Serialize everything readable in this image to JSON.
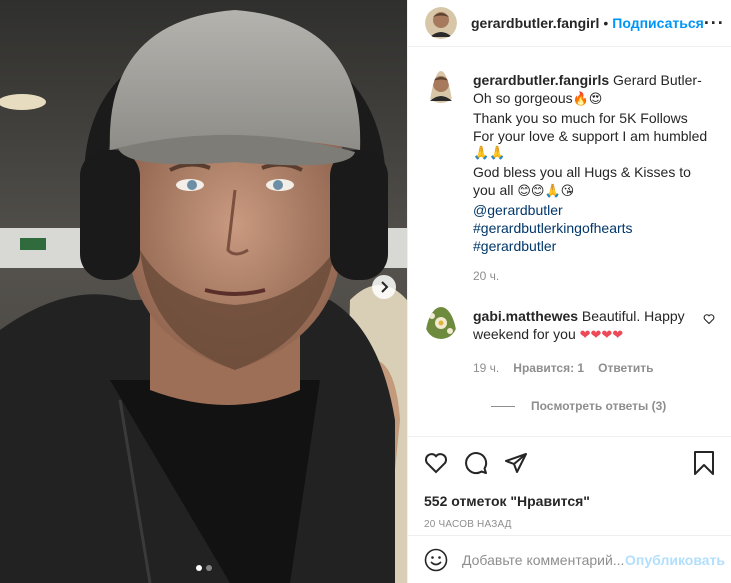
{
  "colors": {
    "accent": "#0095f6",
    "link": "#00376b",
    "muted": "#8e8e8e",
    "heart": "#ed4956",
    "publish_disabled": "#b2dffc"
  },
  "header": {
    "username": "gerardbutler.fangirl",
    "separator": "•",
    "follow_label": "Подписаться",
    "more_label": "···"
  },
  "caption": {
    "username": "gerardbutler.fangirls",
    "text_1": "Gerard Butler-Oh so gorgeous",
    "text_1_emoji": "🔥😍",
    "text_2": "Thank you so much for 5K Follows",
    "text_3": "For your love & support I am humbled",
    "text_3_emoji": "🙏🙏",
    "text_4": "God bless you all Hugs & Kisses to you all",
    "text_4_emoji": "😊😊🙏😘",
    "mentions": [
      "@gerardbutler",
      "#gerardbutlerkingofhearts",
      "#gerardbutler"
    ],
    "time": "20 ч."
  },
  "comment": {
    "username": "gabi.matthewes",
    "text": "Beautiful. Happy weekend for you",
    "emoji": "❤❤❤❤",
    "time": "19 ч.",
    "likes": "Нравится: 1",
    "reply": "Ответить",
    "view_replies": "Посмотреть ответы (3)"
  },
  "actions": {
    "icons": [
      "heart-icon",
      "comment-icon",
      "share-icon",
      "bookmark-icon"
    ],
    "likes_text": "552 отметок \"Нравится\"",
    "date": "20 ЧАСОВ НАЗАД"
  },
  "add_comment": {
    "placeholder": "Добавьте комментарий...",
    "publish_label": "Опубликовать"
  },
  "carousel": {
    "slides": 2,
    "current": 1
  }
}
